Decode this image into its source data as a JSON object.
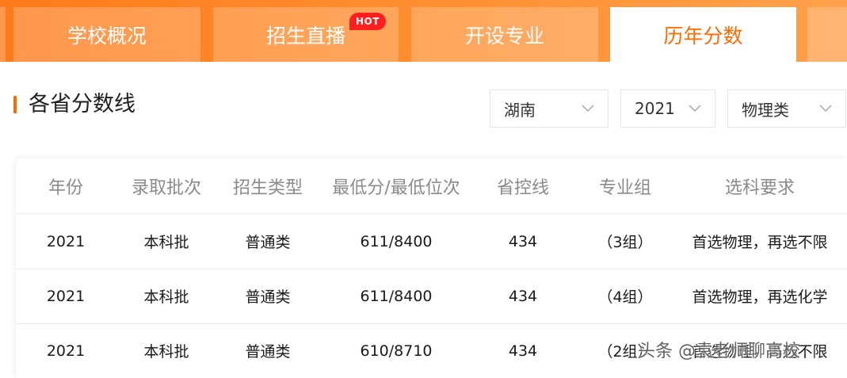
{
  "tabs": [
    {
      "label": "学校概况",
      "active": false
    },
    {
      "label": "招生直播",
      "active": false,
      "badge": "HOT"
    },
    {
      "label": "开设专业",
      "active": false
    },
    {
      "label": "历年分数",
      "active": true
    }
  ],
  "section": {
    "title": "各省分数线"
  },
  "filters": {
    "province": "湖南",
    "year": "2021",
    "subject_type": "物理类"
  },
  "table": {
    "headers": [
      "年份",
      "录取批次",
      "招生类型",
      "最低分/最低位次",
      "省控线",
      "专业组",
      "选科要求"
    ],
    "rows": [
      [
        "2021",
        "本科批",
        "普通类",
        "611/8400",
        "434",
        "（3组）",
        "首选物理，再选不限"
      ],
      [
        "2021",
        "本科批",
        "普通类",
        "611/8400",
        "434",
        "（4组）",
        "首选物理，再选化学"
      ],
      [
        "2021",
        "本科批",
        "普通类",
        "610/8710",
        "434",
        "（2组）",
        "首选物理，再选不限"
      ]
    ]
  },
  "watermark": "头条 @袁老师聊高校",
  "colors": {
    "accent": "#ff6a00",
    "tabbar_start": "#ff7a1a",
    "tabbar_end": "#ffa04a",
    "hot_badge": "#ff1f1f"
  },
  "icons": {
    "filter_dropdown": "chevron-down-icon"
  }
}
